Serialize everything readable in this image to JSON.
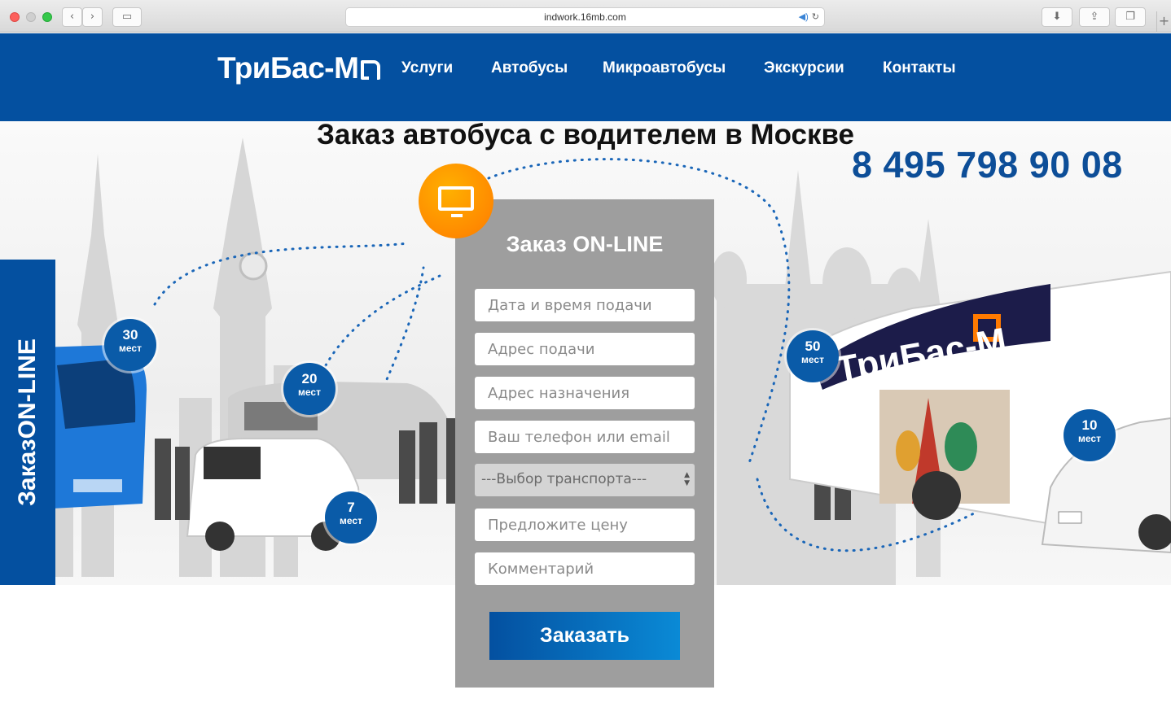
{
  "browser": {
    "url": "indwork.16mb.com",
    "icons": {
      "back": "chevron-left-icon",
      "forward": "chevron-right-icon",
      "sidebar": "sidebar-icon",
      "download": "download-icon",
      "share": "share-icon",
      "tabs": "tabs-icon",
      "new_tab": "plus-icon"
    }
  },
  "site": {
    "logo": "ТриБас-М",
    "nav": [
      "Услуги",
      "Автобусы",
      "Микроавтобусы",
      "Экскурсии",
      "Контакты"
    ]
  },
  "hero": {
    "headline": "Заказ автобуса с водителем в Москве",
    "phone": "8 495 798 90 08",
    "side_tab": "ЗаказON-LINE",
    "bus_logo_text": "ТриБас-М",
    "badges": [
      {
        "number": "30",
        "unit": "мест"
      },
      {
        "number": "20",
        "unit": "мест"
      },
      {
        "number": "7",
        "unit": "мест"
      },
      {
        "number": "50",
        "unit": "мест"
      },
      {
        "number": "10",
        "unit": "мест"
      }
    ]
  },
  "order_form": {
    "title": "Заказ ON-LINE",
    "fields": {
      "datetime": "Дата и время подачи",
      "pickup": "Адрес подачи",
      "destination": "Адрес назначения",
      "contact": "Ваш телефон или email",
      "transport": "---Выбор транспорта---",
      "price": "Предложите цену",
      "comment": "Комментарий"
    },
    "submit": "Заказать"
  },
  "colors": {
    "brand_blue": "#0450a0",
    "phone_blue": "#0d4e98",
    "accent_orange": "#ff9500",
    "form_gray": "#9e9e9e"
  }
}
